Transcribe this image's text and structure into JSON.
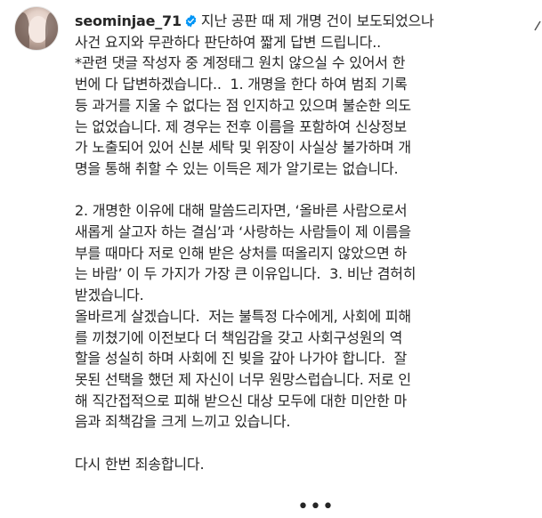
{
  "post": {
    "username": "seominjae_71",
    "caption_first": "지난 공판 때 제 개명 건이 보도되었으나",
    "caption_lines": [
      "사건 요지와 무관하다 판단하여 짧게 답변 드립니다..",
      "*관련 댓글 작성자 중 계정태그 원치 않으실 수 있어서 한",
      "번에 다 답변하겠습니다..  1. 개명을 한다 하여 범죄 기록",
      "등 과거를 지울 수 없다는 점 인지하고 있으며 불순한 의도",
      "는 없었습니다. 제 경우는 전후 이름을 포함하여 신상정보",
      "가 노출되어 있어 신분 세탁 및 위장이 사실상 불가하며 개",
      "명을 통해 취할 수 있는 이득은 제가 알기로는 없습니다.",
      "",
      "2. 개명한 이유에 대해 말씀드리자면, ‘올바른 사람으로서",
      "새롭게 살고자 하는 결심’과 ‘사랑하는 사람들이 제 이름을",
      "부를 때마다 저로 인해 받은 상처를 떠올리지 않았으면 하",
      "는 바람’ 이 두 가지가 가장 큰 이유입니다.  3. 비난 겸허히",
      "받겠습니다.",
      "올바르게 살겠습니다.  저는 불특정 다수에게, 사회에 피해",
      "를 끼쳤기에 이전보다 더 책임감을 갖고 사회구성원의 역",
      "할을 성실히 하며 사회에 진 빚을 갚아 나가야 합니다.  잘",
      "못된 선택을 했던 제 자신이 너무 원망스럽습니다. 저로 인",
      "해 직간접적으로 피해 받으신 대상 모두에 대한 미안한 마",
      "음과 죄책감을 크게 느끼고 있습니다.",
      "",
      "다시 한번 죄송합니다."
    ],
    "more_label": "•••"
  },
  "colors": {
    "text": "#262626",
    "verified_badge": "#0095f6",
    "background": "#ffffff"
  },
  "icons": {
    "verified": "verified-badge-icon",
    "more": "more-options-icon"
  }
}
